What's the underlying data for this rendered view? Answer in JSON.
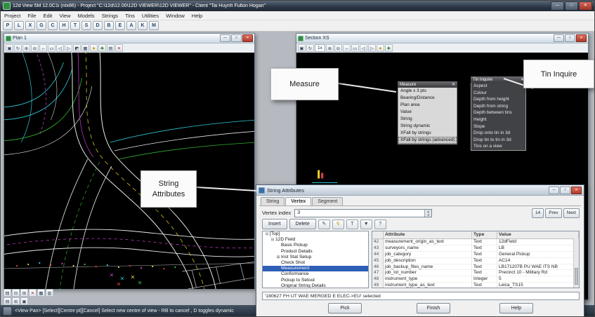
{
  "window": {
    "title": "12d View 5M 12.0C1i (ntx86) - Project \"C:\\12d\\12.00\\12D VIEWER\\12D VIEWER\" - Client \"Tai Huynh Fulton Hogan\"",
    "menus": [
      "Project",
      "File",
      "Edit",
      "View",
      "Models",
      "Strings",
      "Tins",
      "Utilities",
      "Window",
      "Help"
    ],
    "toolbar_letters": [
      "P",
      "L",
      "X",
      "G",
      "C",
      "H",
      "T",
      "S",
      "D",
      "B",
      "E",
      "A",
      "K",
      "M"
    ],
    "status_text": "<View Pan> [Select][Centre pt][Cancel] Select new centre of view - RB to cancel , D toggles dynamic"
  },
  "icons": {
    "minimize": "—",
    "maximize": "□",
    "close": "✕",
    "spinner_up": "▲",
    "spinner_down": "▼"
  },
  "plan_window": {
    "title": "Plan 1",
    "toolbar_icons": [
      "▣",
      "↻",
      "⊕",
      "⊖",
      "↔",
      "▭",
      "◁",
      "▷",
      "◩",
      "▦",
      "★",
      "✚",
      "▤",
      "✕"
    ]
  },
  "section_window": {
    "title": "Section XS",
    "zoom_value": "1x",
    "toolbar_icons": [
      "▣",
      "↻",
      "⊕",
      "⊖",
      "↔",
      "▭",
      "◁",
      "▷",
      "★",
      "✚"
    ]
  },
  "callouts": {
    "measure": "Measure",
    "tin_inquire": "Tin Inquire",
    "string_attributes": "String Attributes"
  },
  "measure_menu": {
    "title": "Measure",
    "items": [
      "Angle x 3 pts",
      "Bearing/Distance",
      "Plan area",
      "Value",
      "String",
      "String dynamic",
      "XFall by strings",
      "XFall by strings (advanced)"
    ]
  },
  "tin_inquire_menu": {
    "title": "Tin Inquire",
    "items": [
      "Aspect",
      "Colour",
      "Depth from height",
      "Depth from string",
      "Depth between tins",
      "Height",
      "Slope",
      "Drop onto tin in 3d",
      "Drop tin to tin in 3d",
      "Tins on a view"
    ]
  },
  "dialog": {
    "title": "String Attributes",
    "tabs": [
      "String",
      "Vertex",
      "Segment"
    ],
    "vertex_index_label": "Vertex index",
    "vertex_index_value": "3",
    "nav_buttons": [
      "14",
      "Prev",
      "Next"
    ],
    "insert_label": "Insert",
    "delete_label": "Delete",
    "toolbar_icons": [
      "✎",
      "↯",
      "T",
      "▼",
      "?"
    ],
    "tree": [
      {
        "g": "⊟",
        "t": "[Top]"
      },
      {
        "g": "⊟",
        "t": "12D Field"
      },
      {
        "g": "",
        "t": "Basic Pickup"
      },
      {
        "g": "",
        "t": "Product Details"
      },
      {
        "g": "⊞",
        "t": "Inst Stat Setup"
      },
      {
        "g": "",
        "t": "Check Shot"
      },
      {
        "g": "",
        "t": "Measurement"
      },
      {
        "g": "",
        "t": "Conformance"
      },
      {
        "g": "",
        "t": "Pickup to Setout"
      },
      {
        "g": "",
        "t": "Original String Details"
      }
    ],
    "table": {
      "headers": [
        "Attribute",
        "Type",
        "Value"
      ],
      "rows": [
        [
          "42",
          "measurement_origin_as_text",
          "Text",
          "12dField"
        ],
        [
          "43",
          "surveyors_name",
          "Text",
          "LB"
        ],
        [
          "44",
          "job_category",
          "Text",
          "General Pickup"
        ],
        [
          "45",
          "job_description",
          "Text",
          "AC14"
        ],
        [
          "46",
          "job_backup_files_name",
          "Text",
          "LB171207B PU WAE ITS NB"
        ],
        [
          "47",
          "job_lot_number",
          "Text",
          "Precinct 10 - Military Rd"
        ],
        [
          "48",
          "instrument_type",
          "Integer",
          "5"
        ],
        [
          "49",
          "instrument_type_as_text",
          "Text",
          "Leica_TS15"
        ]
      ]
    },
    "status_text": "'180627 FH UT WAE MERGED E ELEC->EU' selected",
    "footer_buttons": [
      "Pick",
      "Finish",
      "Help"
    ]
  },
  "bottom_icons": {
    "row1": [
      "▤",
      "⊟",
      "⊞",
      "✕",
      "▦",
      "▥"
    ],
    "row2": [
      "▤",
      "⊞",
      "▣"
    ]
  }
}
